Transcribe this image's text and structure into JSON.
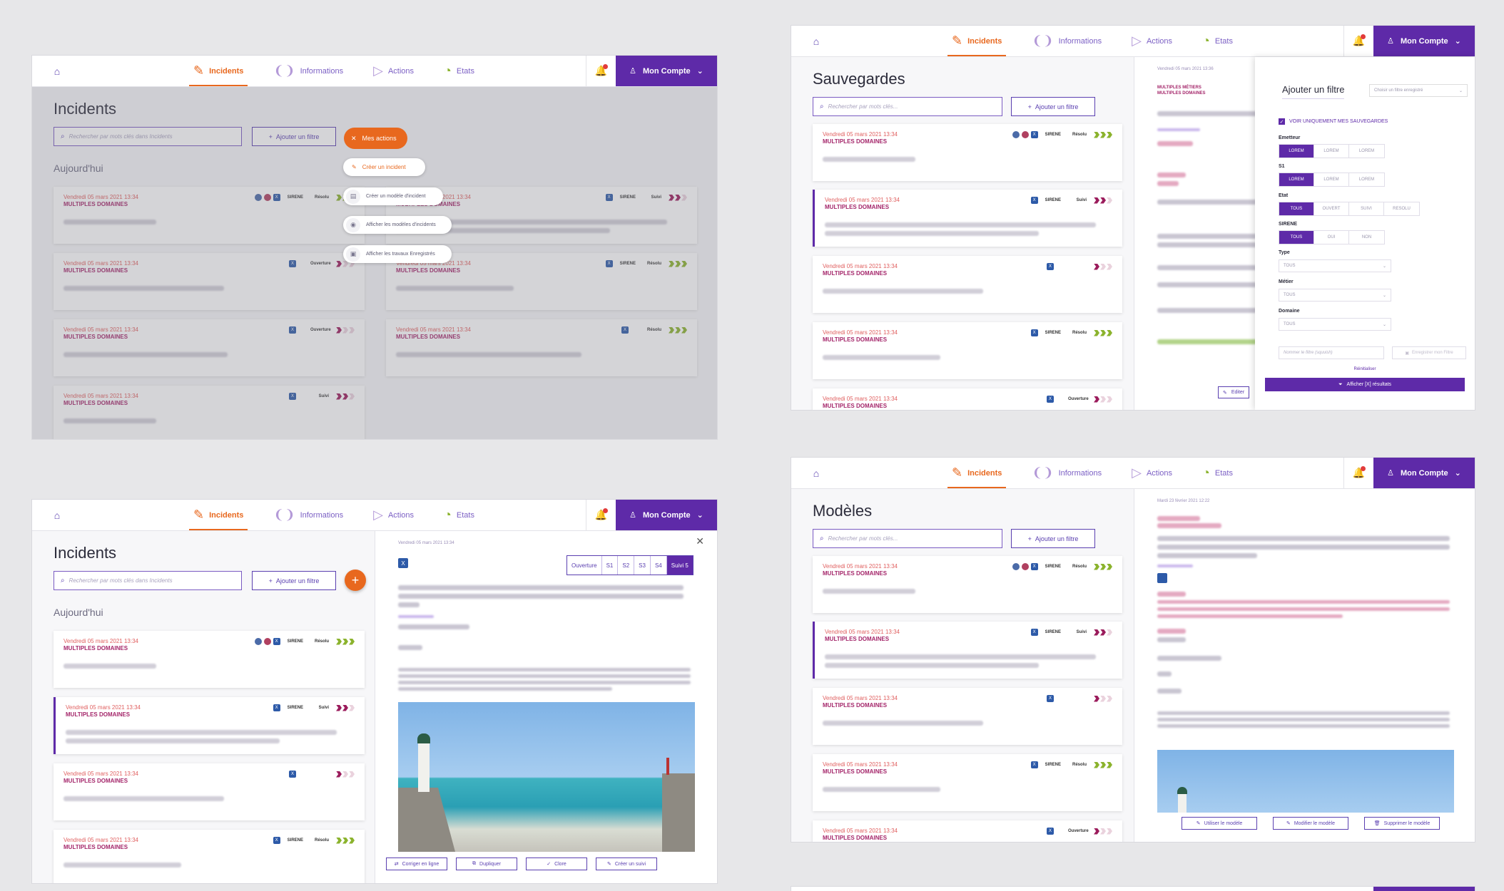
{
  "nav": {
    "tabs": [
      {
        "label": "Incidents",
        "icon": "incidents-icon"
      },
      {
        "label": "Informations",
        "icon": "informations-icon"
      },
      {
        "label": "Actions",
        "icon": "actions-icon"
      },
      {
        "label": "Etats",
        "icon": "etats-icon"
      }
    ],
    "account": "Mon Compte"
  },
  "colors": {
    "primary": "#5e2aa8",
    "accent": "#e8681e",
    "resolved": "#8bb32d",
    "status": "#9b1c5c"
  },
  "card": {
    "date": "Vendredi 05 mars 2021 13:34",
    "domain": "MULTIPLES DOMAINES",
    "sirene": "SIRENE"
  },
  "status": {
    "resolu": "Résolu",
    "suivi": "Suivi",
    "ouverture": "Ouverture"
  },
  "incidents_overlay": {
    "title": "Incidents",
    "search_placeholder": "Rechercher par mots clés dans Incidents",
    "add_filter": "Ajouter un filtre",
    "section": "Aujourd'hui",
    "actions_button": "Mes actions",
    "menu": {
      "create": "Créer un incident",
      "create_model": "Créer un modèle d'incident",
      "show_models": "Afficher les modèles d'incidents",
      "show_saved": "Afficher les travaux Enregistrés"
    }
  },
  "sauvegardes": {
    "title": "Sauvegardes",
    "search_placeholder": "Rechercher par mots clés...",
    "add_filter": "Ajouter un filtre",
    "detail_date": "Vendredi 05 mars 2021 13:36",
    "detail_domains": [
      "MULTIPLES MÉTIERS",
      "MULTIPLES DOMAINES"
    ],
    "edit": "Editer"
  },
  "filter": {
    "title": "Ajouter un filtre",
    "saved_placeholder": "Choisir un filtre enregistré",
    "only_mine": "VOIR UNIQUEMENT MES SAUVEGARDES",
    "emetteur": {
      "label": "Emetteur",
      "options": [
        "LOREM",
        "LOREM",
        "LOREM"
      ]
    },
    "s1": {
      "label": "S1",
      "options": [
        "LOREM",
        "LOREM",
        "LOREM"
      ]
    },
    "etat": {
      "label": "Etat",
      "options": [
        "TOUS",
        "OUVERT",
        "SUIVI",
        "RESOLU"
      ]
    },
    "sirene": {
      "label": "SIRENE",
      "options": [
        "TOUS",
        "OUI",
        "NON"
      ]
    },
    "type": {
      "label": "Type",
      "value": "TOUS"
    },
    "metier": {
      "label": "Métier",
      "value": "TOUS"
    },
    "domaine": {
      "label": "Domaine",
      "value": "TOUS"
    },
    "name_placeholder": "Nommer le filtre (squuish)",
    "save": "Enregistrer mon Filtre",
    "reset": "Réinitialiser",
    "show": "Afficher [X] résultats"
  },
  "incidents_detail": {
    "title": "Incidents",
    "search_placeholder": "Rechercher par mots clés dans Incidents",
    "add_filter": "Ajouter un filtre",
    "section": "Aujourd'hui",
    "detail_date": "Vendredi 05 mars 2021 13:34",
    "steps": [
      "Ouverture",
      "S1",
      "S2",
      "S3",
      "S4",
      "Suivi 5"
    ],
    "buttons": [
      "Corriger en ligne",
      "Dupliquer",
      "Clore",
      "Créer un suivi"
    ]
  },
  "modeles": {
    "title": "Modèles",
    "search_placeholder": "Rechercher par mots clés...",
    "add_filter": "Ajouter un filtre",
    "detail_date": "Mardi 23 février 2021 12:22",
    "buttons": [
      "Utiliser le modèle",
      "Modifier le modèle",
      "Supprimer le modèle"
    ]
  }
}
